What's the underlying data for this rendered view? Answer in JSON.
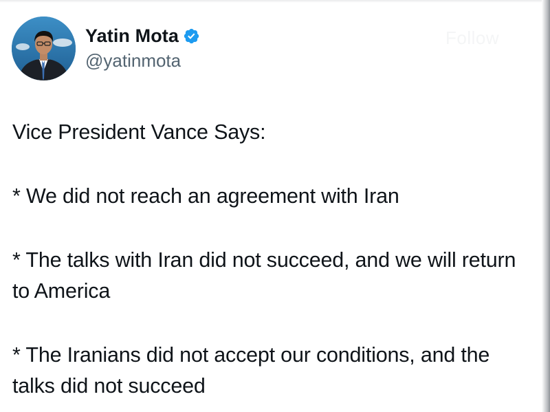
{
  "author": {
    "display_name": "Yatin Mota",
    "handle": "@yatinmota",
    "verified": true,
    "verified_color": "#1d9bf0",
    "avatar_icon": "profile-photo"
  },
  "header": {
    "faded_button_label": "Follow"
  },
  "tweet": {
    "lines": [
      "Vice President Vance Says:",
      "* We did not reach an agreement with Iran",
      "* The talks with Iran did not succeed, and we will return to America",
      "* The Iranians did not accept our conditions, and the talks did not succeed"
    ]
  },
  "colors": {
    "text": "#0f1419",
    "secondary": "#536471",
    "background": "#ffffff"
  }
}
